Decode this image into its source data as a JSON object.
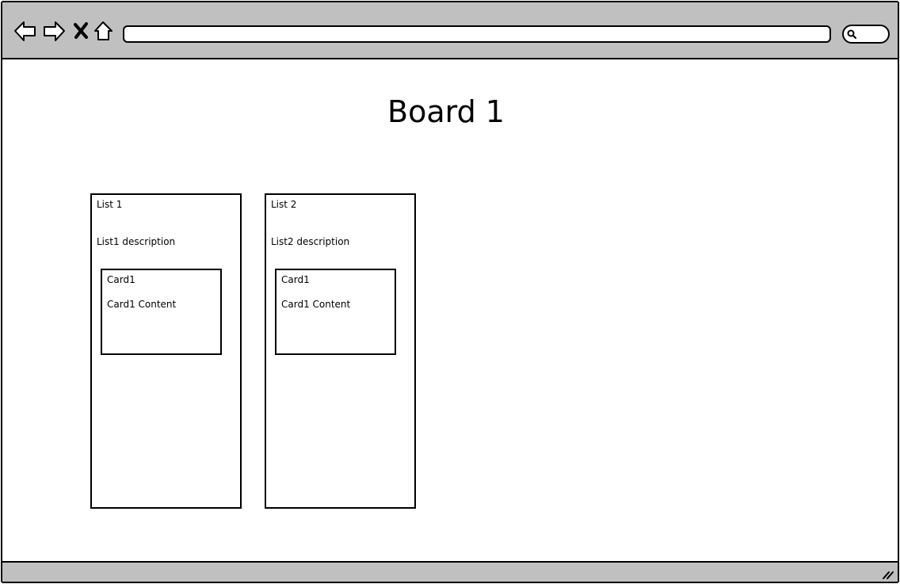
{
  "browser": {
    "url": "",
    "icons": [
      "back-arrow-icon",
      "forward-arrow-icon",
      "close-icon",
      "home-icon",
      "search-icon",
      "resize-grip-icon"
    ]
  },
  "board": {
    "title": "Board 1"
  },
  "lists": [
    {
      "title": "List 1",
      "description": "List1 description",
      "cards": [
        {
          "title": "Card1",
          "content": "Card1 Content"
        }
      ]
    },
    {
      "title": "List 2",
      "description": "List2 description",
      "cards": [
        {
          "title": "Card1",
          "content": "Card1 Content"
        }
      ]
    }
  ]
}
